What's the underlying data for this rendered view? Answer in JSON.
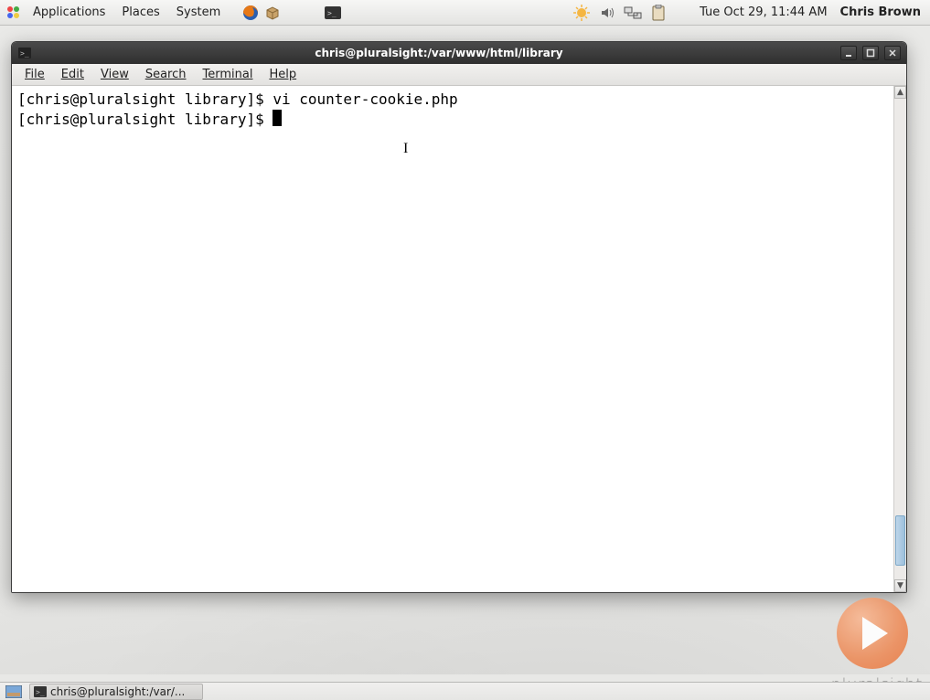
{
  "top_panel": {
    "menus": [
      "Applications",
      "Places",
      "System"
    ],
    "datetime": "Tue Oct 29, 11:44 AM",
    "user": "Chris Brown"
  },
  "window": {
    "title": "chris@pluralsight:/var/www/html/library",
    "menubar": [
      "File",
      "Edit",
      "View",
      "Search",
      "Terminal",
      "Help"
    ],
    "terminal": {
      "lines": [
        {
          "prompt": "[chris@pluralsight library]$ ",
          "command": "vi counter-cookie.php"
        },
        {
          "prompt": "[chris@pluralsight library]$ ",
          "command": ""
        }
      ]
    }
  },
  "bottom_panel": {
    "task_label": "chris@pluralsight:/var/..."
  },
  "watermark": "pluralsight",
  "icons": {
    "apps": "apps-icon",
    "firefox": "firefox-icon",
    "box": "package-icon",
    "term_small": "terminal-small-icon",
    "weather": "weather-icon",
    "sound": "sound-icon",
    "network": "network-icon",
    "clipboard": "clipboard-icon"
  }
}
